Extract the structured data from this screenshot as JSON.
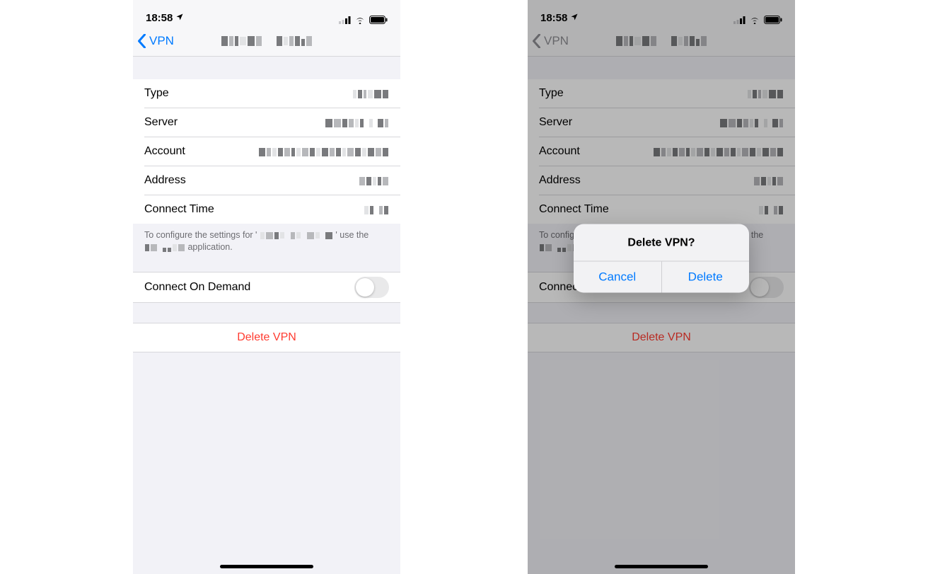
{
  "statusbar": {
    "time": "18:58"
  },
  "nav": {
    "back_label": "VPN"
  },
  "details": {
    "rows": [
      {
        "label": "Type"
      },
      {
        "label": "Server"
      },
      {
        "label": "Account"
      },
      {
        "label": "Address"
      },
      {
        "label": "Connect Time"
      }
    ],
    "footer_prefix": "To configure the settings for '",
    "footer_middle": "' use the",
    "footer_suffix": "application."
  },
  "connect_on_demand": {
    "label": "Connect On Demand",
    "on": false
  },
  "delete": {
    "label": "Delete VPN"
  },
  "alert": {
    "title": "Delete VPN?",
    "cancel": "Cancel",
    "delete": "Delete"
  }
}
